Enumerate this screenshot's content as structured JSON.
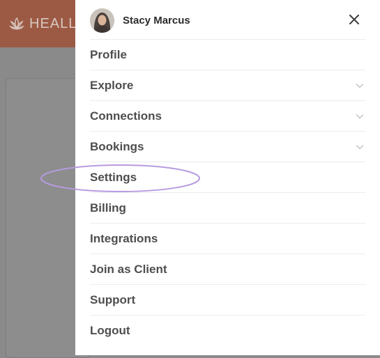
{
  "app": {
    "logo_text": "HEALLI",
    "brand_color": "#9c5a45"
  },
  "user": {
    "name": "Stacy Marcus"
  },
  "menu": {
    "items": [
      {
        "label": "Profile",
        "expandable": false
      },
      {
        "label": "Explore",
        "expandable": true
      },
      {
        "label": "Connections",
        "expandable": true
      },
      {
        "label": "Bookings",
        "expandable": true
      },
      {
        "label": "Settings",
        "expandable": false,
        "highlighted": true
      },
      {
        "label": "Billing",
        "expandable": false
      },
      {
        "label": "Integrations",
        "expandable": false
      },
      {
        "label": "Join as Client",
        "expandable": false
      },
      {
        "label": "Support",
        "expandable": false
      },
      {
        "label": "Logout",
        "expandable": false
      }
    ]
  },
  "icons": {
    "close": "close-icon",
    "chevron": "chevron-down-icon",
    "logo": "lotus-logo-icon"
  },
  "colors": {
    "highlight": "#b79be0",
    "menu_text": "#4e4e4e"
  }
}
